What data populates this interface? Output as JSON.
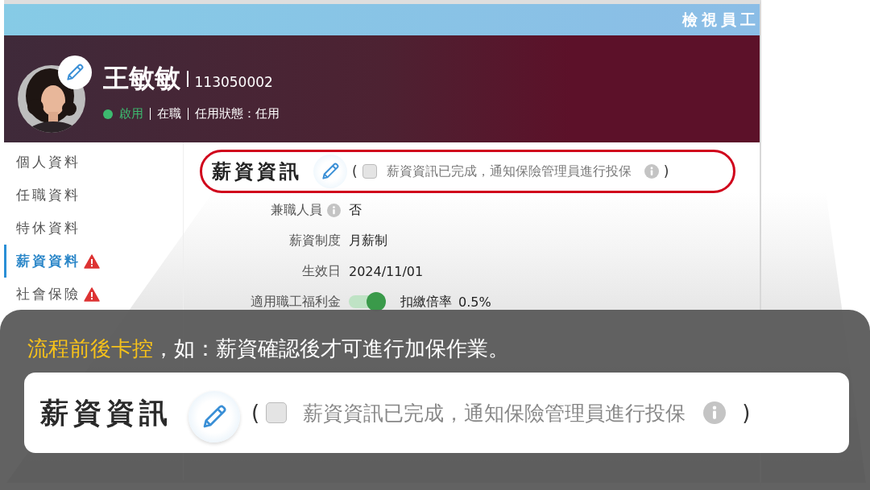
{
  "window": {
    "title": "檢視員工"
  },
  "employee": {
    "name": "王敏敏",
    "id": "113050002",
    "status": {
      "label": "啟用",
      "color": "#3dba6f"
    },
    "employment": "在職",
    "appointment": "任用狀態：任用"
  },
  "sidebar": {
    "items": [
      {
        "label": "個人資料",
        "selected": false,
        "warning": false
      },
      {
        "label": "任職資料",
        "selected": false,
        "warning": false
      },
      {
        "label": "特休資料",
        "selected": false,
        "warning": false
      },
      {
        "label": "薪資資料",
        "selected": true,
        "warning": true
      },
      {
        "label": "社會保險",
        "selected": false,
        "warning": true
      }
    ]
  },
  "section": {
    "title": "薪資資訊",
    "open_paren": "(",
    "close_paren": ")",
    "checkbox": {
      "label": "薪資資訊已完成，通知保險管理員進行投保",
      "checked": false
    }
  },
  "fields": [
    {
      "kind": "text",
      "label": "兼職人員",
      "info": true,
      "value": "否"
    },
    {
      "kind": "text",
      "label": "薪資制度",
      "info": false,
      "value": "月薪制"
    },
    {
      "kind": "text",
      "label": "生效日",
      "info": false,
      "value": "2024/11/01"
    },
    {
      "kind": "toggle",
      "label": "適用職工福利金",
      "on": true,
      "extra_label": "扣繳倍率",
      "extra_value": "0.5%"
    }
  ],
  "callout": {
    "text": "**流程前後卡控**，如：薪資確認後才可進行加保作業。",
    "card": {
      "title": "薪資資訊",
      "open_paren": "(",
      "close_paren": ")",
      "checkbox": {
        "label": "薪資資訊已完成，通知保險管理員進行投保",
        "checked": false
      }
    }
  }
}
